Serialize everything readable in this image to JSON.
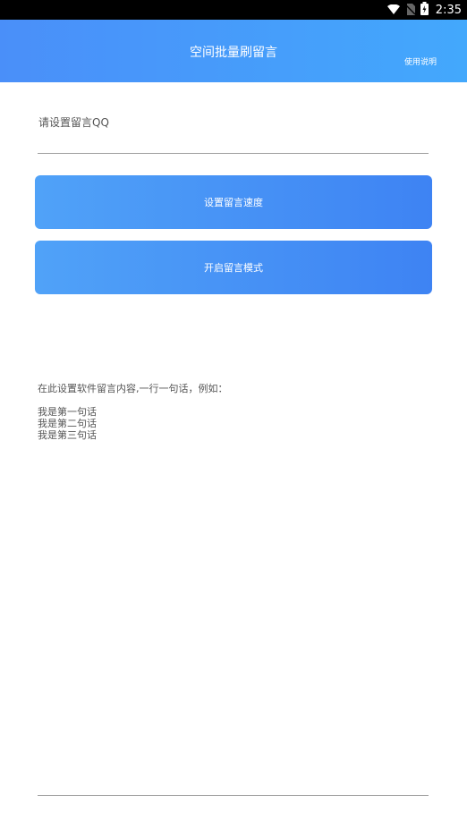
{
  "status_bar": {
    "time": "2:35",
    "icons": [
      "wifi-icon",
      "no-sim-icon",
      "battery-charging-icon"
    ]
  },
  "header": {
    "title": "空间批量刷留言",
    "help_label": "使用说明",
    "gradient": [
      "#4a8ff9",
      "#43a8fc"
    ]
  },
  "qq_input": {
    "label": "请设置留言QQ",
    "value": ""
  },
  "buttons": {
    "set_speed": "设置留言速度",
    "start_mode": "开启留言模式",
    "gradient": [
      "#50a2f8",
      "#3e83f3"
    ]
  },
  "content": {
    "hint": "在此设置软件留言内容,一行一句话，例如：",
    "examples": [
      "我是第一句话",
      "我是第二句话",
      "我是第三句话"
    ]
  }
}
